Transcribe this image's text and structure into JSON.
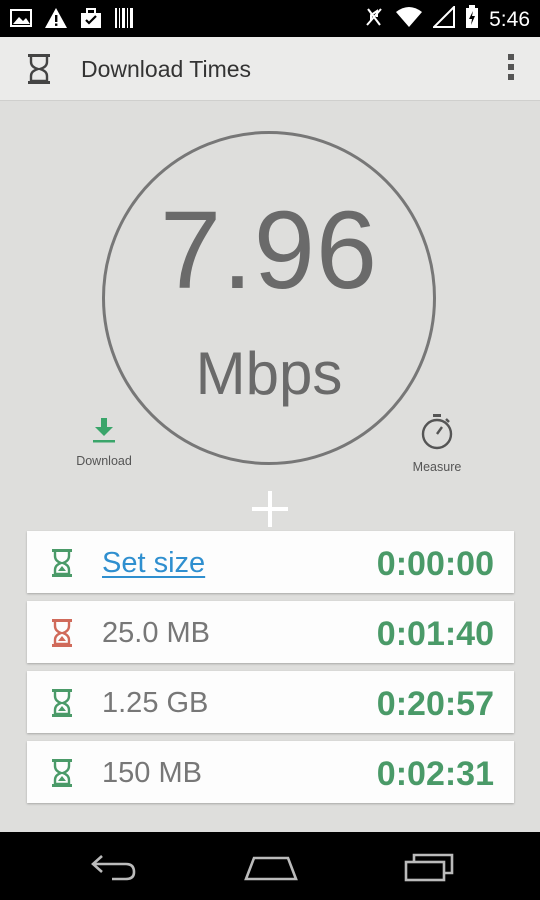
{
  "status_bar": {
    "time": "5:46",
    "icons_left": [
      "image-icon",
      "warning-icon",
      "briefcase-icon",
      "barcode-icon"
    ],
    "icons_right": [
      "mute-icon",
      "wifi-icon",
      "signal-icon",
      "battery-charging-icon"
    ]
  },
  "action_bar": {
    "title": "Download Times",
    "app_icon": "hourglass-icon",
    "menu_icon": "overflow-menu-icon"
  },
  "gauge": {
    "speed": "7.96",
    "unit": "Mbps"
  },
  "actions": {
    "download_label": "Download",
    "measure_label": "Measure"
  },
  "rows": [
    {
      "size": "Set size",
      "time": "0:00:00",
      "is_link": true,
      "hourglass_color": "#4a9a68"
    },
    {
      "size": "25.0 MB",
      "time": "0:01:40",
      "is_link": false,
      "hourglass_color": "#d06a5a"
    },
    {
      "size": "1.25 GB",
      "time": "0:20:57",
      "is_link": false,
      "hourglass_color": "#4a9a68"
    },
    {
      "size": "150 MB",
      "time": "0:02:31",
      "is_link": false,
      "hourglass_color": "#4a9a68"
    }
  ],
  "colors": {
    "accent_green": "#4a9a68",
    "link_blue": "#2f8fcf",
    "background": "#dededc"
  },
  "nav_bar": {
    "icons": [
      "back-icon",
      "home-icon",
      "recents-icon"
    ]
  }
}
